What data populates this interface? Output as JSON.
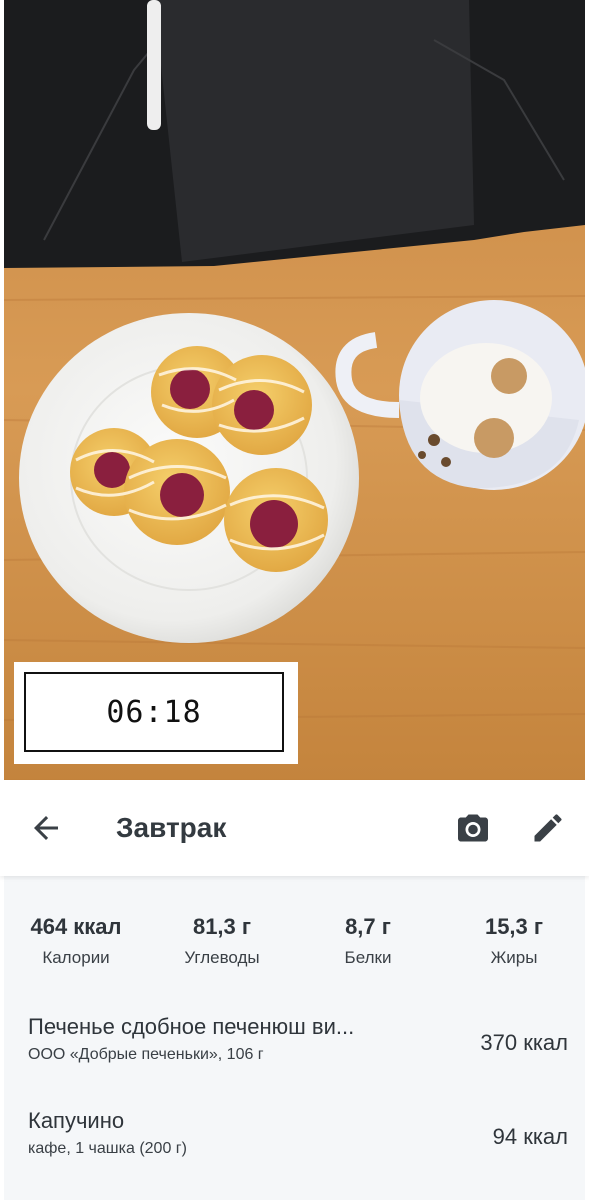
{
  "photo": {
    "time_label": "06:18"
  },
  "header": {
    "title": "Завтрак",
    "back_icon": "arrow-left-icon",
    "camera_icon": "camera-icon",
    "edit_icon": "pencil-icon"
  },
  "summary": {
    "calories": {
      "value": "464 ккал",
      "label": "Калории"
    },
    "carbs": {
      "value": "81,3 г",
      "label": "Углеводы"
    },
    "protein": {
      "value": "8,7 г",
      "label": "Белки"
    },
    "fat": {
      "value": "15,3 г",
      "label": "Жиры"
    }
  },
  "items": [
    {
      "name": "Печенье сдобное печенюш ви...",
      "details": "ООО «Добрые печеньки», 106 г",
      "kcal": "370 ккал"
    },
    {
      "name": "Капучино",
      "details": "кафе, 1 чашка (200 г)",
      "kcal": "94 ккал"
    }
  ],
  "colors": {
    "header_bg": "#ffffff",
    "content_bg": "#f5f7f9",
    "text": "#2f353b",
    "icon": "#3a4046"
  }
}
